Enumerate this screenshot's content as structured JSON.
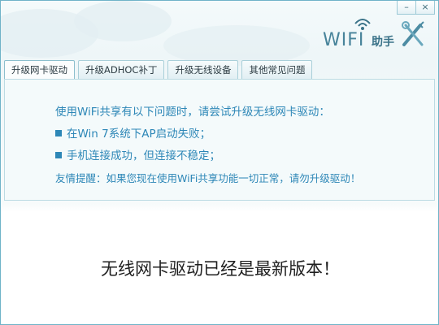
{
  "window": {
    "minimize_label": "–",
    "close_label": "×",
    "logo_text": "WIFI",
    "logo_sub": "助手"
  },
  "tabs": [
    {
      "label": "升级网卡驱动",
      "active": true
    },
    {
      "label": "升级ADHOC补丁",
      "active": false
    },
    {
      "label": "升级无线设备",
      "active": false
    },
    {
      "label": "其他常见问题",
      "active": false
    }
  ],
  "info": {
    "intro": "使用WiFi共享有以下问题时，请尝试升级无线网卡驱动：",
    "bullets": [
      "在Win 7系统下AP启动失败；",
      "手机连接成功，但连接不稳定；"
    ],
    "tip": "友情提醒：如果您现在使用WiFi共享功能一切正常，请勿升级驱动！"
  },
  "status": {
    "message": "无线网卡驱动已经是最新版本！"
  },
  "colors": {
    "accent": "#2d87b7",
    "border": "#6fb3c8"
  }
}
